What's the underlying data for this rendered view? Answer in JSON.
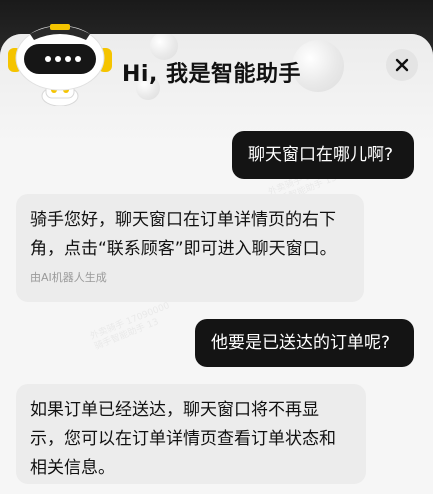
{
  "header": {
    "title": "Hi, 我是智能助手",
    "close_icon": "close-icon"
  },
  "messages": [
    {
      "role": "user",
      "text": "聊天窗口在哪儿啊?"
    },
    {
      "role": "assistant",
      "lines": [
        "骑手您好，聊天窗口在订单详情页的右下",
        "角，点击“联系顾客”即可进入聊天窗口。"
      ],
      "footer": "由AI机器人生成"
    },
    {
      "role": "user",
      "text": "他要是已送达的订单呢?"
    },
    {
      "role": "assistant",
      "lines": [
        "如果订单已经送达，聊天窗口将不再显",
        "示，您可以在订单详情页查看订单状态和",
        "相关信息。"
      ]
    }
  ],
  "colors": {
    "user_bubble": "#141414",
    "bot_bubble": "#ececec",
    "sheet": "#f6f6f6"
  }
}
